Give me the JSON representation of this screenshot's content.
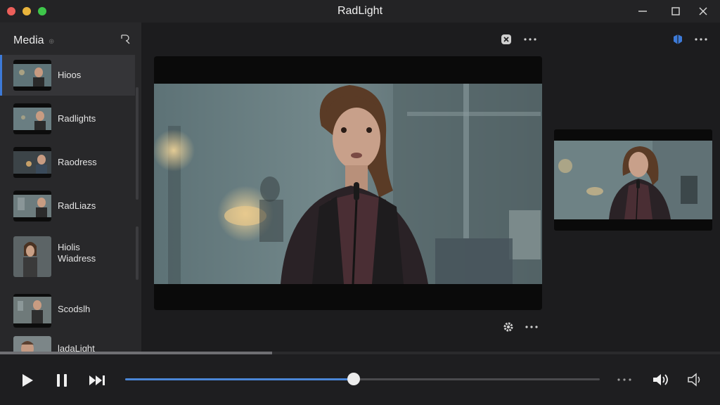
{
  "window": {
    "title": "RadLight"
  },
  "sidebar": {
    "title": "Media",
    "items": [
      {
        "label": "Hioos",
        "active": true
      },
      {
        "label": "Radlights",
        "active": false
      },
      {
        "label": "Raodress",
        "active": false
      },
      {
        "label": "RadLiazs",
        "active": false
      },
      {
        "label": "Hiolis\nWiadress",
        "active": false
      },
      {
        "label": "Scodslh",
        "active": false
      },
      {
        "label": "ladaLight",
        "active": false
      }
    ]
  },
  "player": {
    "progress_fraction": 0.482,
    "buffer_fraction": 0.378
  },
  "icons": {
    "search": "search-icon",
    "media": "media-icon",
    "more": "more-icon",
    "settings": "gear-icon",
    "play": "play-icon",
    "pause": "pause-icon",
    "skip": "skip-forward-icon",
    "volume": "volume-icon"
  },
  "colors": {
    "accent": "#4a86d6",
    "sidebar_active": "#353538",
    "traffic_red": "#ec5f5a",
    "traffic_yellow": "#e9b43c",
    "traffic_green": "#3ec64a"
  }
}
